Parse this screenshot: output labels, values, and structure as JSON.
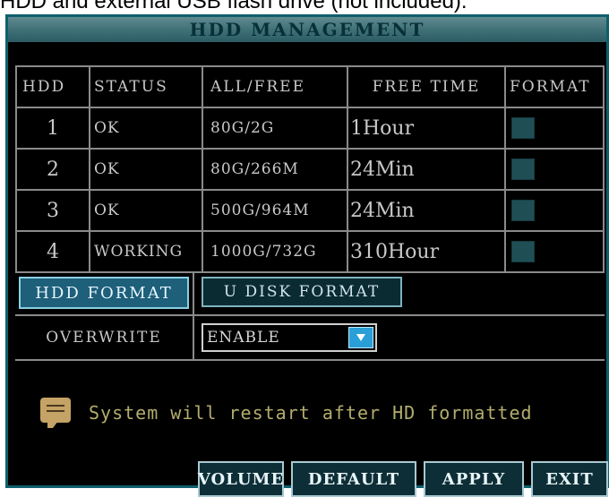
{
  "caption": "HDD and external USB flash drive (not included).",
  "window": {
    "title": "HDD MANAGEMENT"
  },
  "table": {
    "headers": [
      "HDD",
      "STATUS",
      "ALL/FREE",
      "FREE TIME",
      "FORMAT"
    ],
    "rows": [
      {
        "hdd": "1",
        "status": "OK",
        "all_free": "80G/2G",
        "free_time": "1Hour"
      },
      {
        "hdd": "2",
        "status": "OK",
        "all_free": "80G/266M",
        "free_time": "24Min"
      },
      {
        "hdd": "3",
        "status": "OK",
        "all_free": "500G/964M",
        "free_time": "24Min"
      },
      {
        "hdd": "4",
        "status": "WORKING",
        "all_free": "1000G/732G",
        "free_time": "310Hour"
      }
    ]
  },
  "buttons": {
    "hdd_format": "HDD FORMAT",
    "u_disk_format": "U DISK FORMAT",
    "volume": "VOLUME",
    "default": "DEFAULT",
    "apply": "APPLY",
    "exit": "EXIT"
  },
  "overwrite": {
    "label": "OVERWRITE",
    "value": "ENABLE"
  },
  "notice": {
    "icon": "message-icon",
    "text": "System will restart after HD formatted"
  },
  "colors": {
    "panel_bg": "#000000",
    "title_bar": "#4a7b82",
    "accent_blue": "#1e5f7a",
    "checkbox": "#1f4f55",
    "notice_text": "#b3ad6d"
  }
}
